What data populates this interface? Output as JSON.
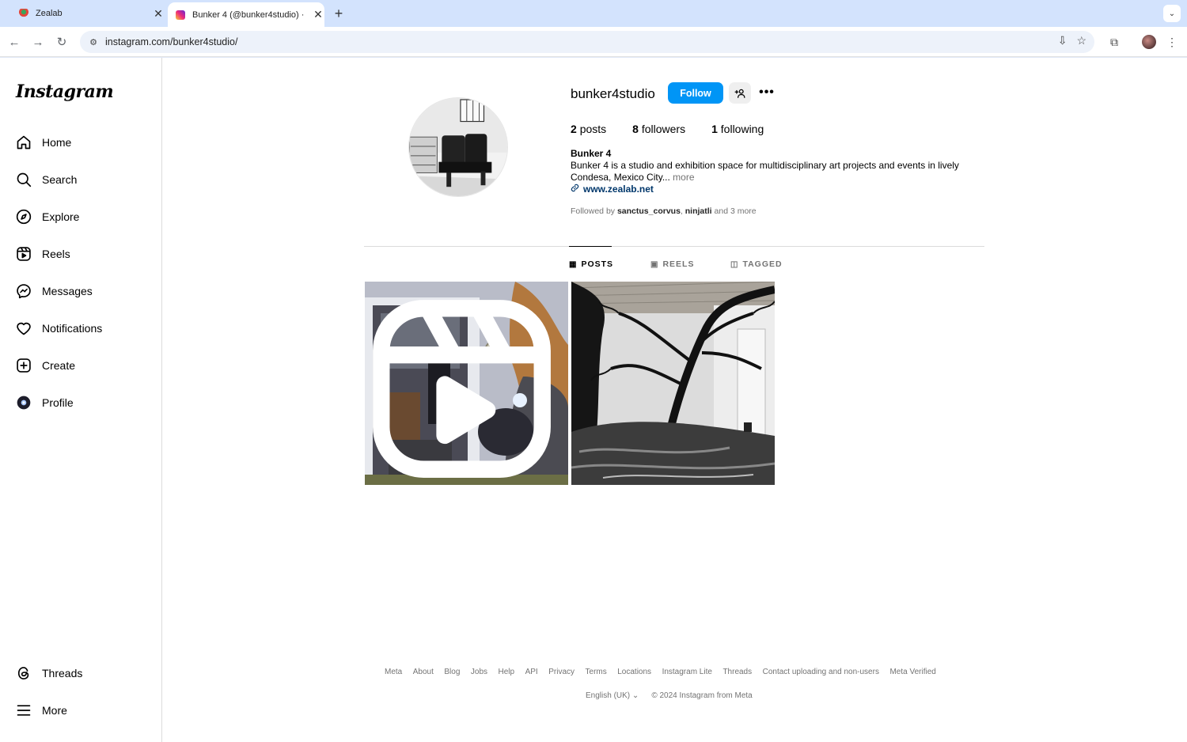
{
  "browser": {
    "tabs": [
      {
        "title": "Zealab"
      },
      {
        "title": "Bunker 4 (@bunker4studio) ·"
      }
    ],
    "url": "instagram.com/bunker4studio/"
  },
  "sidebar": {
    "logo": "Instagram",
    "items": [
      {
        "label": "Home"
      },
      {
        "label": "Search"
      },
      {
        "label": "Explore"
      },
      {
        "label": "Reels"
      },
      {
        "label": "Messages"
      },
      {
        "label": "Notifications"
      },
      {
        "label": "Create"
      },
      {
        "label": "Profile"
      }
    ],
    "bottom": [
      {
        "label": "Threads"
      },
      {
        "label": "More"
      }
    ]
  },
  "profile": {
    "username": "bunker4studio",
    "follow_label": "Follow",
    "stats": {
      "posts_count": "2",
      "posts_label": "posts",
      "followers_count": "8",
      "followers_label": "followers",
      "following_count": "1",
      "following_label": "following"
    },
    "full_name": "Bunker 4",
    "bio": "Bunker 4 is a studio and exhibition space for multidisciplinary art projects and events in lively Condesa, Mexico City...",
    "bio_more": "more",
    "link": "www.zealab.net",
    "followed_by_prefix": "Followed by",
    "followed_by_user1": "sanctus_corvus",
    "followed_by_user2": "ninjatli",
    "followed_by_suffix": "and 3 more"
  },
  "tabs": [
    {
      "label": "POSTS",
      "active": true
    },
    {
      "label": "REELS",
      "active": false
    },
    {
      "label": "TAGGED",
      "active": false
    }
  ],
  "footer": {
    "links": [
      "Meta",
      "About",
      "Blog",
      "Jobs",
      "Help",
      "API",
      "Privacy",
      "Terms",
      "Locations",
      "Instagram Lite",
      "Threads",
      "Contact uploading and non-users",
      "Meta Verified"
    ],
    "language": "English (UK)",
    "copyright": "© 2024 Instagram from Meta"
  },
  "colors": {
    "accent": "#0095f6",
    "link": "#00376b",
    "muted": "#737373"
  }
}
